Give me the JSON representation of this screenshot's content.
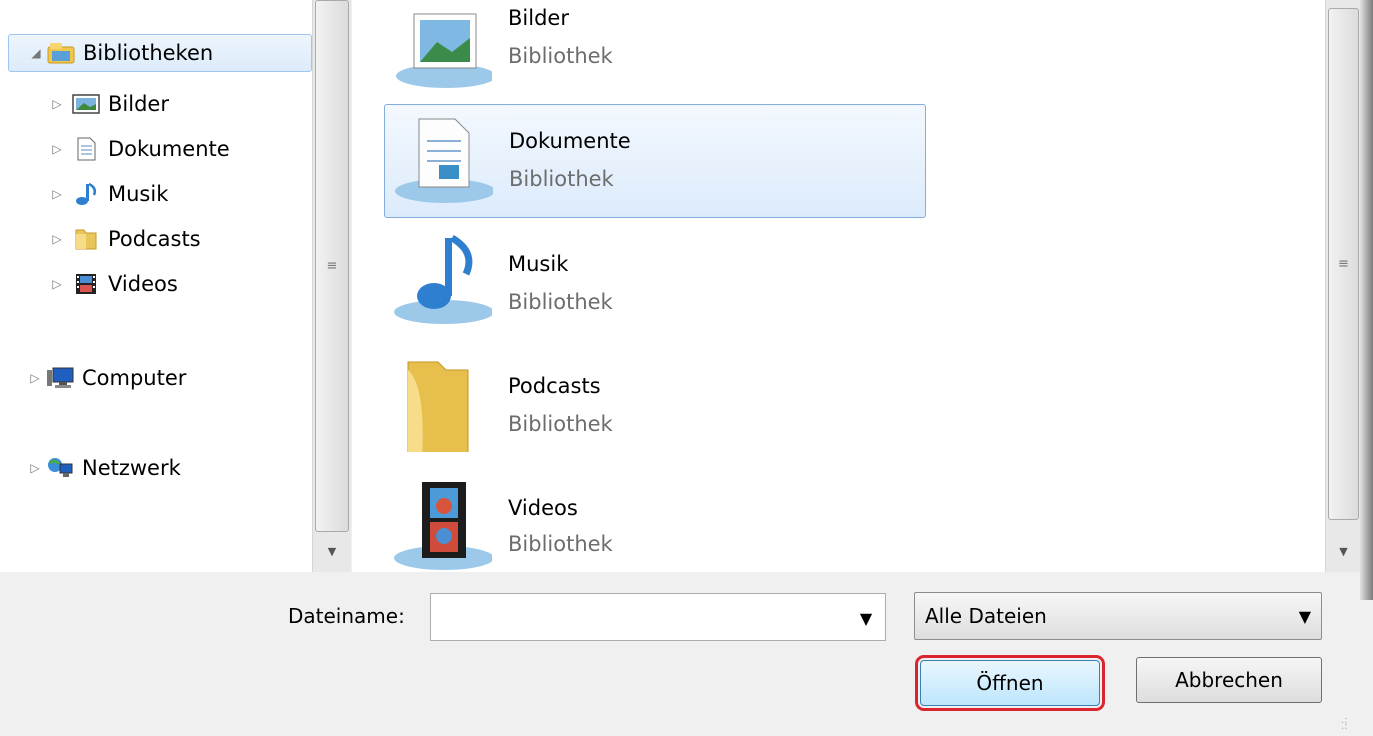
{
  "nav": {
    "libraries": "Bibliotheken",
    "items": [
      "Bilder",
      "Dokumente",
      "Musik",
      "Podcasts",
      "Videos"
    ],
    "computer": "Computer",
    "network": "Netzwerk"
  },
  "content": {
    "items": [
      {
        "name": "Bilder",
        "type": "Bibliothek"
      },
      {
        "name": "Dokumente",
        "type": "Bibliothek"
      },
      {
        "name": "Musik",
        "type": "Bibliothek"
      },
      {
        "name": "Podcasts",
        "type": "Bibliothek"
      },
      {
        "name": "Videos",
        "type": "Bibliothek"
      }
    ]
  },
  "footer": {
    "filename_label": "Dateiname:",
    "filename_value": "",
    "filetype_value": "Alle Dateien",
    "open_label": "Öffnen",
    "cancel_label": "Abbrechen"
  },
  "colors": {
    "selection": "#dcebfb",
    "highlight": "#d9262e"
  },
  "icons": {
    "libraries": "libraries-icon",
    "pictures": "pictures-icon",
    "documents": "documents-icon",
    "music": "music-icon",
    "podcasts": "folder-icon",
    "videos": "videos-icon",
    "computer": "computer-icon",
    "network": "network-icon"
  }
}
